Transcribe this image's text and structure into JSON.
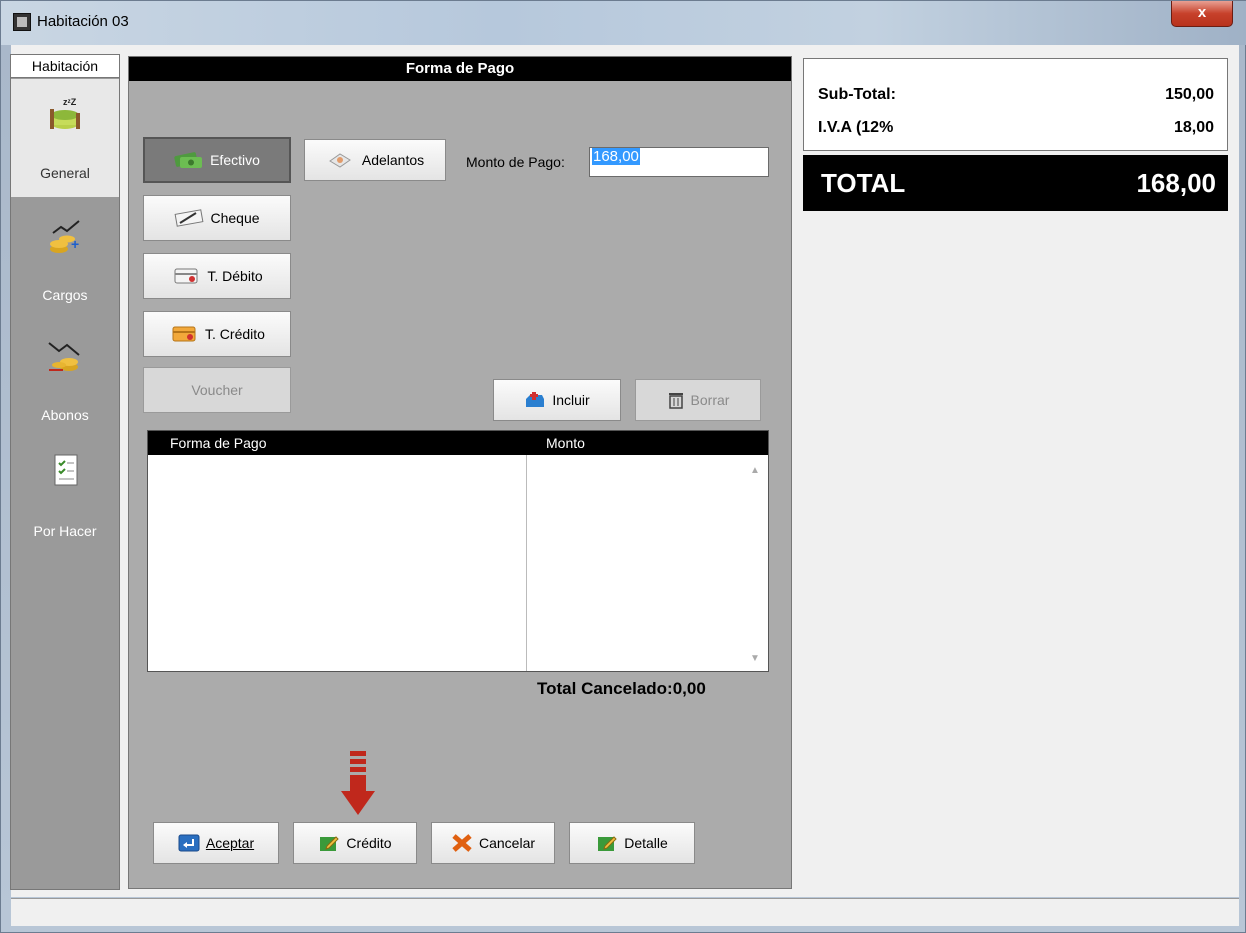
{
  "window": {
    "title": "Habitación 03",
    "close_label": "x"
  },
  "nav": {
    "header": "Habitación",
    "items": [
      {
        "label": "General",
        "icon": "bed-sleep-icon",
        "active": true
      },
      {
        "label": "Cargos",
        "icon": "coins-charge-icon",
        "active": false
      },
      {
        "label": "Abonos",
        "icon": "coins-payment-icon",
        "active": false
      },
      {
        "label": "Por Hacer",
        "icon": "checklist-icon",
        "active": false
      }
    ]
  },
  "payment": {
    "title": "Forma de Pago",
    "buttons": {
      "efectivo": "Efectivo",
      "adelantos": "Adelantos",
      "cheque": "Cheque",
      "debito": "T. Débito",
      "credito_card": "T. Crédito",
      "voucher": "Voucher",
      "incluir": "Incluir",
      "borrar": "Borrar"
    },
    "monto_label": "Monto de Pago:",
    "monto_value": "168,00",
    "grid_headers": [
      "Forma de Pago",
      "Monto"
    ],
    "total_cancelado": "Total Cancelado:0,00"
  },
  "footer_buttons": {
    "aceptar": "Aceptar",
    "credito": "Crédito",
    "cancelar": "Cancelar",
    "detalle": "Detalle"
  },
  "summary": {
    "subtotal_label": "Sub-Total:",
    "subtotal_value": "150,00",
    "iva_label": "I.V.A (12%",
    "iva_value": "18,00",
    "total_label": "TOTAL",
    "total_value": "168,00"
  },
  "colors": {
    "accent_red": "#c0281c",
    "header_black": "#000000",
    "panel_gray": "#ababab"
  }
}
